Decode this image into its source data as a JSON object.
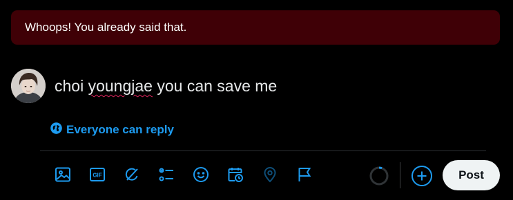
{
  "alert": {
    "message": "Whoops! You already said that."
  },
  "composer": {
    "text_part1": "choi ",
    "text_misspelled": "youngjae",
    "text_part2": " you can save me",
    "reply_setting_label": "Everyone can reply"
  },
  "toolbar": {
    "tools": [
      "image-icon",
      "gif-icon",
      "grok-icon",
      "poll-icon",
      "emoji-icon",
      "schedule-icon",
      "location-icon",
      "flag-icon"
    ],
    "gif_label": "GIF",
    "accent_color": "#1d9bf0",
    "disabled_color": "#0e4e78"
  },
  "actions": {
    "post_label": "Post"
  },
  "colors": {
    "alert_background": "#3f0006",
    "accent": "#1d9bf0",
    "background": "#000000",
    "divider": "#2f3336"
  }
}
